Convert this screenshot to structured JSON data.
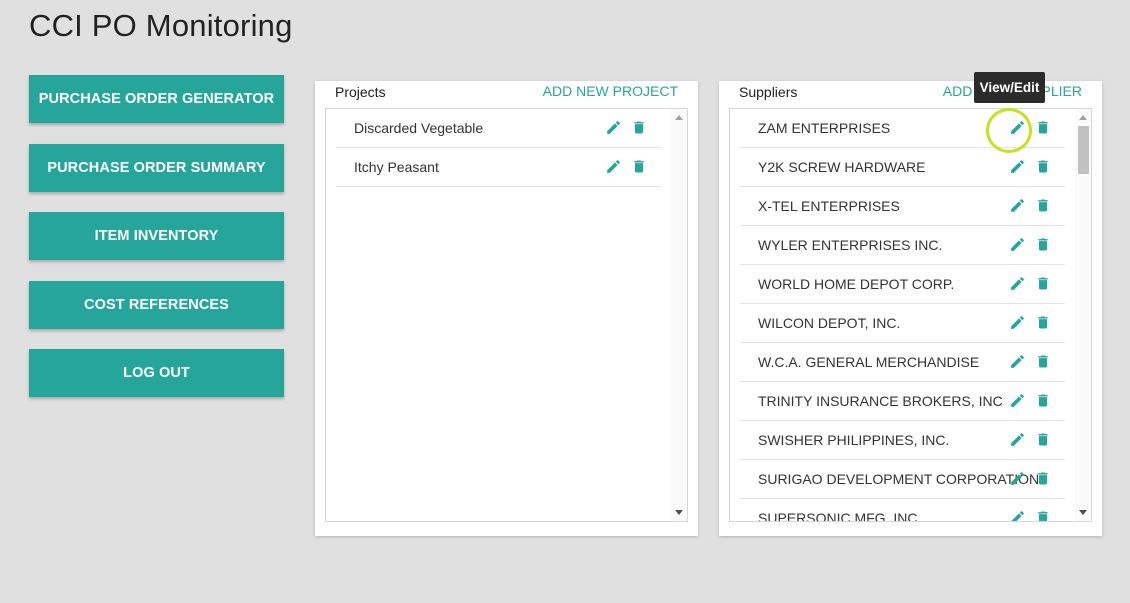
{
  "app": {
    "title": "CCI PO Monitoring"
  },
  "nav": {
    "items": [
      {
        "label": "PURCHASE ORDER GENERATOR"
      },
      {
        "label": "PURCHASE ORDER SUMMARY"
      },
      {
        "label": "ITEM INVENTORY"
      },
      {
        "label": "COST REFERENCES"
      },
      {
        "label": "LOG OUT"
      }
    ]
  },
  "projects": {
    "title": "Projects",
    "action_label": "ADD NEW PROJECT",
    "items": [
      {
        "name": "Discarded Vegetable"
      },
      {
        "name": "Itchy Peasant"
      }
    ]
  },
  "suppliers": {
    "title": "Suppliers",
    "action_label": "ADD NEW SUPPLIER",
    "items": [
      {
        "name": "ZAM ENTERPRISES"
      },
      {
        "name": "Y2K SCREW HARDWARE"
      },
      {
        "name": "X-TEL ENTERPRISES"
      },
      {
        "name": "WYLER ENTERPRISES INC."
      },
      {
        "name": "WORLD HOME DEPOT CORP."
      },
      {
        "name": "WILCON DEPOT, INC."
      },
      {
        "name": "W.C.A. GENERAL MERCHANDISE"
      },
      {
        "name": "TRINITY INSURANCE BROKERS, INC"
      },
      {
        "name": "SWISHER PHILIPPINES, INC."
      },
      {
        "name": "SURIGAO DEVELOPMENT CORPORATION"
      },
      {
        "name": "SUPERSONIC MFG. INC."
      }
    ]
  },
  "tooltip": {
    "text": "View/Edit"
  },
  "icons": {
    "edit": "pencil-icon",
    "delete": "trash-icon"
  },
  "colors": {
    "accent": "#26a69a",
    "background": "#e0e0e0",
    "highlight": "#c6e21e",
    "tooltip_bg": "#2b2b2b"
  }
}
